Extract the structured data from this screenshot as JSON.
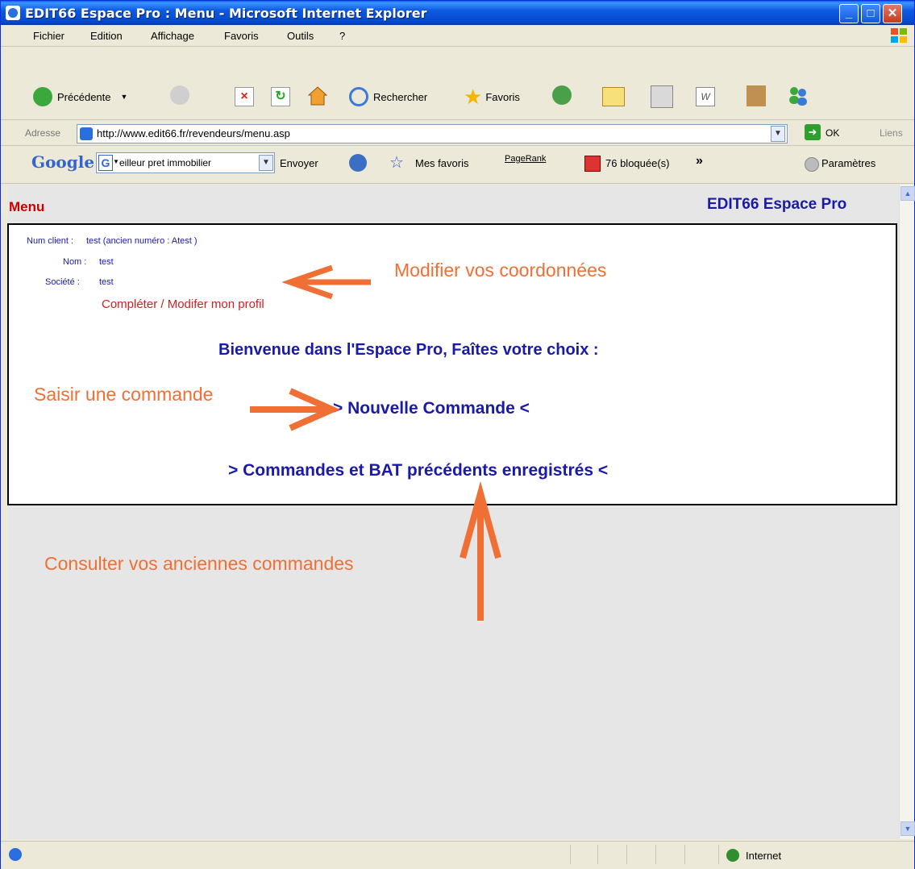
{
  "window": {
    "title": "EDIT66 Espace Pro : Menu - Microsoft Internet Explorer",
    "controls": {
      "minimize": "_",
      "maximize": "□",
      "close": "✕"
    }
  },
  "menubar": {
    "items": [
      "Fichier",
      "Edition",
      "Affichage",
      "Favoris",
      "Outils",
      "?"
    ]
  },
  "toolbar": {
    "back_label": "Précédente",
    "search_label": "Rechercher",
    "favorites_label": "Favoris"
  },
  "address": {
    "label": "Adresse",
    "url": "http://www.edit66.fr/revendeurs/menu.asp",
    "go_label": "OK",
    "links_label": "Liens"
  },
  "googlebar": {
    "logo": "Google",
    "search_value": "eilleur pret immobilier",
    "send_label": "Envoyer",
    "favorites_label": "Mes favoris",
    "pagerank_label": "PageRank",
    "popups_label": "76 bloquée(s)",
    "more_label": "»",
    "settings_label": "Paramètres"
  },
  "page": {
    "menu_title": "Menu",
    "brand": "EDIT66 Espace Pro",
    "client": {
      "num_label": "Num client :",
      "num_value": "test (ancien numéro : Atest )",
      "name_label": "Nom :",
      "name_value": "test",
      "company_label": "Société :",
      "company_value": "test"
    },
    "profile_link": "Compléter / Modifer mon profil",
    "welcome": "Bienvenue dans l'Espace Pro, Faîtes votre choix :",
    "new_order_link": "> Nouvelle Commande <",
    "old_orders_link": "> Commandes et BAT précédents enregistrés <"
  },
  "annotations": {
    "modify": "Modifier vos coordonnées",
    "enter_order": "Saisir une commande",
    "consult": "Consulter vos anciennes commandes",
    "color": "#f06f34"
  },
  "statusbar": {
    "zone": "Internet"
  }
}
